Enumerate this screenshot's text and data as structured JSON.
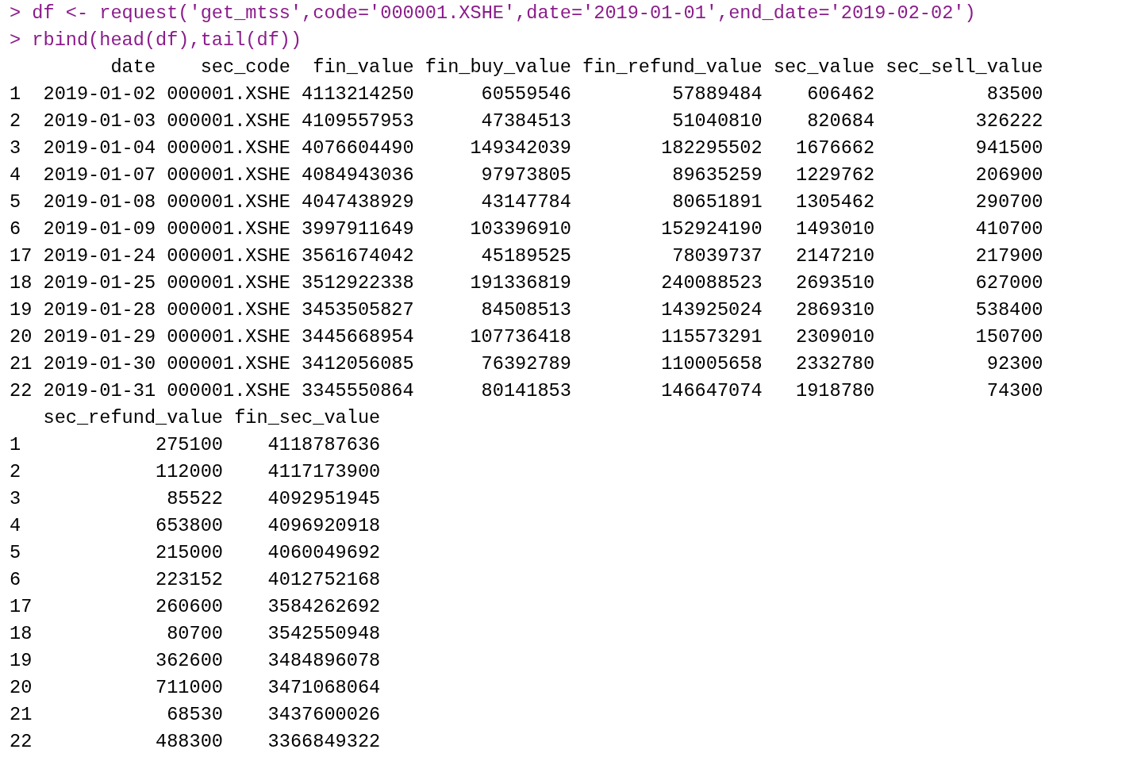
{
  "console": {
    "commands": [
      {
        "prompt": ">",
        "code": "df <- request('get_mtss',code='000001.XSHE',date='2019-01-01',end_date='2019-02-02')"
      },
      {
        "prompt": ">",
        "code": "rbind(head(df),tail(df))"
      }
    ],
    "output_blocks": [
      {
        "columns": [
          "date",
          "sec_code",
          "fin_value",
          "fin_buy_value",
          "fin_refund_value",
          "sec_value",
          "sec_sell_value"
        ],
        "rows": [
          {
            "row_name": "1",
            "values": [
              "2019-01-02",
              "000001.XSHE",
              "4113214250",
              "60559546",
              "57889484",
              "606462",
              "83500"
            ]
          },
          {
            "row_name": "2",
            "values": [
              "2019-01-03",
              "000001.XSHE",
              "4109557953",
              "47384513",
              "51040810",
              "820684",
              "326222"
            ]
          },
          {
            "row_name": "3",
            "values": [
              "2019-01-04",
              "000001.XSHE",
              "4076604490",
              "149342039",
              "182295502",
              "1676662",
              "941500"
            ]
          },
          {
            "row_name": "4",
            "values": [
              "2019-01-07",
              "000001.XSHE",
              "4084943036",
              "97973805",
              "89635259",
              "1229762",
              "206900"
            ]
          },
          {
            "row_name": "5",
            "values": [
              "2019-01-08",
              "000001.XSHE",
              "4047438929",
              "43147784",
              "80651891",
              "1305462",
              "290700"
            ]
          },
          {
            "row_name": "6",
            "values": [
              "2019-01-09",
              "000001.XSHE",
              "3997911649",
              "103396910",
              "152924190",
              "1493010",
              "410700"
            ]
          },
          {
            "row_name": "17",
            "values": [
              "2019-01-24",
              "000001.XSHE",
              "3561674042",
              "45189525",
              "78039737",
              "2147210",
              "217900"
            ]
          },
          {
            "row_name": "18",
            "values": [
              "2019-01-25",
              "000001.XSHE",
              "3512922338",
              "191336819",
              "240088523",
              "2693510",
              "627000"
            ]
          },
          {
            "row_name": "19",
            "values": [
              "2019-01-28",
              "000001.XSHE",
              "3453505827",
              "84508513",
              "143925024",
              "2869310",
              "538400"
            ]
          },
          {
            "row_name": "20",
            "values": [
              "2019-01-29",
              "000001.XSHE",
              "3445668954",
              "107736418",
              "115573291",
              "2309010",
              "150700"
            ]
          },
          {
            "row_name": "21",
            "values": [
              "2019-01-30",
              "000001.XSHE",
              "3412056085",
              "76392789",
              "110005658",
              "2332780",
              "92300"
            ]
          },
          {
            "row_name": "22",
            "values": [
              "2019-01-31",
              "000001.XSHE",
              "3345550864",
              "80141853",
              "146647074",
              "1918780",
              "74300"
            ]
          }
        ]
      },
      {
        "columns": [
          "sec_refund_value",
          "fin_sec_value"
        ],
        "rows": [
          {
            "row_name": "1",
            "values": [
              "275100",
              "4118787636"
            ]
          },
          {
            "row_name": "2",
            "values": [
              "112000",
              "4117173900"
            ]
          },
          {
            "row_name": "3",
            "values": [
              "85522",
              "4092951945"
            ]
          },
          {
            "row_name": "4",
            "values": [
              "653800",
              "4096920918"
            ]
          },
          {
            "row_name": "5",
            "values": [
              "215000",
              "4060049692"
            ]
          },
          {
            "row_name": "6",
            "values": [
              "223152",
              "4012752168"
            ]
          },
          {
            "row_name": "17",
            "values": [
              "260600",
              "3584262692"
            ]
          },
          {
            "row_name": "18",
            "values": [
              "80700",
              "3542550948"
            ]
          },
          {
            "row_name": "19",
            "values": [
              "362600",
              "3484896078"
            ]
          },
          {
            "row_name": "20",
            "values": [
              "711000",
              "3471068064"
            ]
          },
          {
            "row_name": "21",
            "values": [
              "68530",
              "3437600026"
            ]
          },
          {
            "row_name": "22",
            "values": [
              "488300",
              "3366849322"
            ]
          }
        ]
      }
    ]
  }
}
